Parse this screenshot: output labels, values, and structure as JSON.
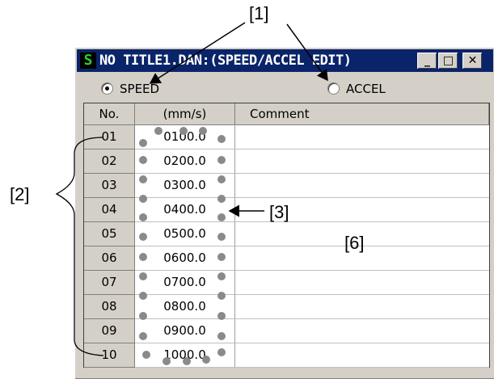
{
  "callouts": {
    "c1": "[1]",
    "c2": "[2]",
    "c3": "[3]",
    "c6": "[6]"
  },
  "window": {
    "icon_letter": "S",
    "title": "NO TITLE1.DAN:(SPEED/ACCEL EDIT)",
    "minimize_glyph": "_",
    "maximize_glyph": "□",
    "close_glyph": "✕"
  },
  "mode": {
    "speed_label": "SPEED",
    "accel_label": "ACCEL",
    "selected": "SPEED"
  },
  "table": {
    "columns": [
      "No.",
      "(mm/s)",
      "Comment"
    ],
    "rows": [
      {
        "no": "01",
        "value": "0100.0",
        "comment": ""
      },
      {
        "no": "02",
        "value": "0200.0",
        "comment": ""
      },
      {
        "no": "03",
        "value": "0300.0",
        "comment": ""
      },
      {
        "no": "04",
        "value": "0400.0",
        "comment": ""
      },
      {
        "no": "05",
        "value": "0500.0",
        "comment": ""
      },
      {
        "no": "06",
        "value": "0600.0",
        "comment": ""
      },
      {
        "no": "07",
        "value": "0700.0",
        "comment": ""
      },
      {
        "no": "08",
        "value": "0800.0",
        "comment": ""
      },
      {
        "no": "09",
        "value": "0900.0",
        "comment": ""
      },
      {
        "no": "10",
        "value": "1000.0",
        "comment": ""
      }
    ]
  },
  "colors": {
    "titlebar": "#0a246a",
    "window_face": "#d4d0c8",
    "icon_text": "#33cc33",
    "highlight_dots": "#8a8a8a"
  }
}
